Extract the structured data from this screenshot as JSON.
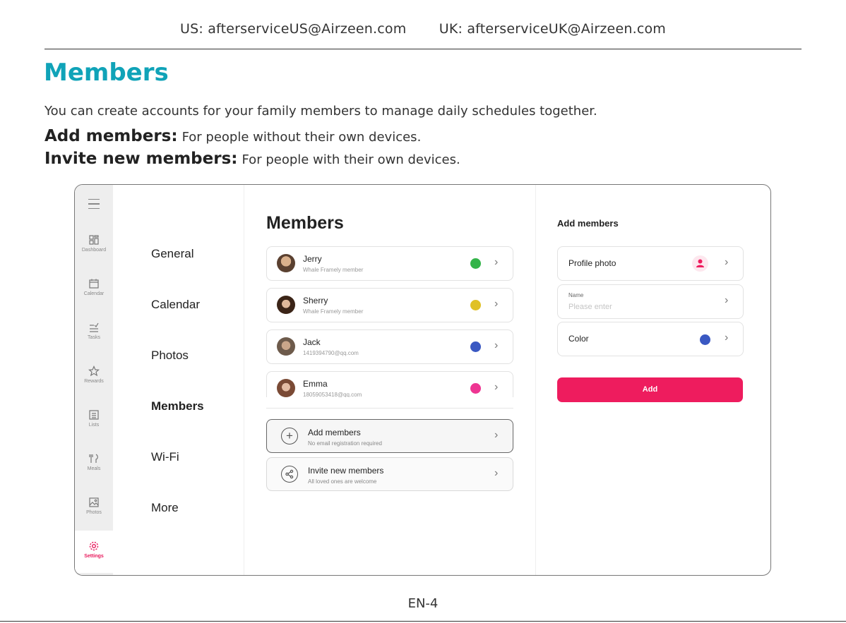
{
  "header": {
    "us_contact": "US: afterserviceUS@Airzeen.com",
    "uk_contact": "UK: afterserviceUK@Airzeen.com"
  },
  "doc": {
    "title": "Members",
    "intro": "You can create accounts for your family members to manage daily schedules together.",
    "add_term": "Add members:",
    "add_desc": "For people without their own devices.",
    "invite_term": "Invite new members:",
    "invite_desc": "For people with their own devices.",
    "page_number": "EN-4"
  },
  "rail": {
    "items": [
      {
        "label": "Dashboard",
        "icon": "dashboard-icon"
      },
      {
        "label": "Calendar",
        "icon": "calendar-icon"
      },
      {
        "label": "Tasks",
        "icon": "tasks-icon"
      },
      {
        "label": "Rewards",
        "icon": "star-icon"
      },
      {
        "label": "Lists",
        "icon": "list-icon"
      },
      {
        "label": "Meals",
        "icon": "meals-icon"
      },
      {
        "label": "Photos",
        "icon": "photo-icon"
      },
      {
        "label": "Settings",
        "icon": "gear-icon"
      }
    ],
    "active_color": "#e8195c"
  },
  "settings_menu": {
    "items": [
      "General",
      "Calendar",
      "Photos",
      "Members",
      "Wi-Fi",
      "More"
    ],
    "active": "Members"
  },
  "members_panel": {
    "title": "Members",
    "members": [
      {
        "name": "Jerry",
        "sub": "Whale Framely member",
        "color": "#34b44a"
      },
      {
        "name": "Sherry",
        "sub": "Whale Framely member",
        "color": "#e0c126"
      },
      {
        "name": "Jack",
        "sub": "1419394790@qq.com",
        "color": "#3a58c2"
      },
      {
        "name": "Emma",
        "sub": "18059053418@qq.com",
        "color": "#ee3592"
      }
    ],
    "actions": [
      {
        "title": "Add members",
        "sub": "No email registration required",
        "icon": "plus-circle-icon"
      },
      {
        "title": "Invite new members",
        "sub": "All loved ones are welcome",
        "icon": "share-icon"
      }
    ]
  },
  "add_panel": {
    "title": "Add members",
    "profile_label": "Profile photo",
    "name_label": "Name",
    "name_placeholder": "Please enter",
    "color_label": "Color",
    "selected_color": "#3a58c2",
    "submit_label": "Add",
    "accent": "#ee1c5e"
  }
}
